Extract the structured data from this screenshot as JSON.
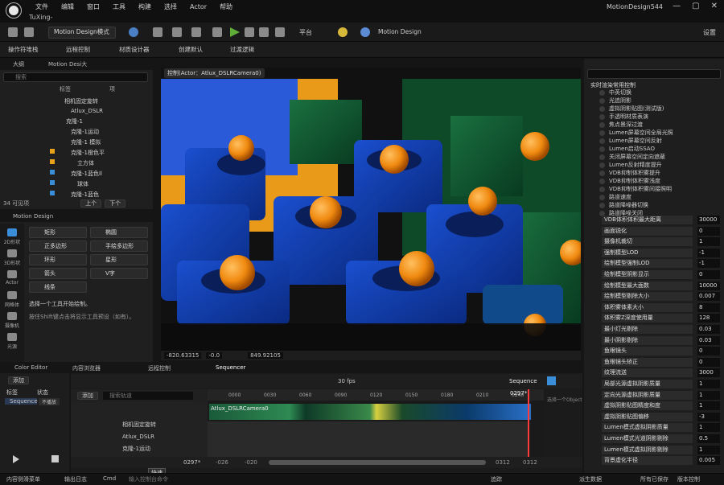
{
  "titlebar": {
    "menus": [
      "文件",
      "编辑",
      "窗口",
      "工具",
      "构建",
      "选择",
      "Actor",
      "帮助"
    ],
    "project": "TuXing-",
    "window_name": "MotionDesign544"
  },
  "toolbar": {
    "mode": "Motion Design模式",
    "platform": "平台",
    "md": "Motion Design",
    "settings": "设置"
  },
  "toolbar2": {
    "items": [
      "操作符堆栈",
      "远程控制",
      "材质设计器",
      "创建默认",
      "过渡逻辑"
    ]
  },
  "outliner": {
    "tab": "大纲",
    "tab2": "Motion Desi大",
    "search": "搜索",
    "col_label": "标签",
    "col_item": "项",
    "rows": [
      "相机固定旋转",
      "Atlux_DSLR",
      "克隆-1",
      "克隆-1运动",
      "克隆-1 模拟",
      "克隆-1橙色平",
      "立方体",
      "克隆-1蓝色Il",
      "球体",
      "克隆-1蓝色"
    ],
    "count": "34 可见项",
    "btn_up": "上个",
    "btn_down": "下个"
  },
  "motion": {
    "tab": "Motion Design",
    "left": [
      "2D形状",
      "3D形状",
      "Actor",
      "网格体",
      "摄像机",
      "光源"
    ],
    "shapes": [
      "矩形",
      "椭圆",
      "正多边形",
      "手绘多边形",
      "环形",
      "星形",
      "箭头",
      "V字",
      "线条"
    ],
    "hint1": "选择一个工具开始绘制。",
    "hint2": "按住Shift键点击将显示工具预设（如有）。"
  },
  "viewport": {
    "title": "控制(Actor：Atlux_DSLRCamera0)",
    "coords": [
      "-820.63315",
      "-0.0",
      "849.92105"
    ]
  },
  "right": {
    "section": "实时渲染常用控制",
    "toggles": [
      "中英切换",
      "光追阴影",
      "虚拟阴影贴图(测试版)",
      "手透明材质表演",
      "焦点景深过渡",
      "Lumen屏幕空间全局光照",
      "Lumen屏幕空间反射",
      "Lumen启动SSAO",
      "关闭屏幕空间定向遮蔽",
      "Lumen反射精度提升",
      "VDB抑制体积雾提升",
      "VDB抑制体积雾浅度",
      "VDB抑制体积雾间接照明",
      "路道速度",
      "路道降噪器切换",
      "路道降噪关闭"
    ],
    "props": [
      [
        "VDB体积体积最大距离",
        "30000"
      ],
      [
        "画面锐化",
        "0"
      ],
      [
        "摄像机裁切",
        "1"
      ],
      [
        "强制模型LOD",
        "-1"
      ],
      [
        "绘制模型强制LOD",
        "-1"
      ],
      [
        "绘制模型阴影显示",
        "0"
      ],
      [
        "绘制模型最大面数",
        "10000"
      ],
      [
        "绘制模型剔除大小",
        "0.007"
      ],
      [
        "体积雾体素大小",
        "8"
      ],
      [
        "体积雾Z深度使用量",
        "128"
      ],
      [
        "最小灯光剔除",
        "0.03"
      ],
      [
        "最小阴影剔除",
        "0.03"
      ],
      [
        "鱼眼镜头",
        "0"
      ],
      [
        "鱼眼镜头矫正",
        "0"
      ],
      [
        "纹理流送",
        "3000"
      ],
      [
        "局部光源虚拟阴影质量",
        "1"
      ],
      [
        "定向光源虚拟阴影质量",
        "1"
      ],
      [
        "虚拟阴影贴图精度和度",
        "1"
      ],
      [
        "虚拟阴影贴图偏移",
        "-3"
      ],
      [
        "Lumen模式虚拟阴影质量",
        "1"
      ],
      [
        "Lumen模式光道阴影剔除",
        "0.5"
      ],
      [
        "Lumen模式虚拟阴影剔除",
        "1"
      ],
      [
        "背景虚化半径",
        "0.005"
      ]
    ]
  },
  "bottom": {
    "tabs": [
      "Color Editor",
      "内容浏览器",
      "远程控制",
      "Sequencer"
    ],
    "color": {
      "add": "添加",
      "label": "标签",
      "state": "状态",
      "seq": "Sequence",
      "notplay": "不播放"
    },
    "seq": {
      "fps": "30 fps",
      "name": "Sequence",
      "add": "添加",
      "search": "搜索轨道",
      "tracks": [
        "相机固定旋转",
        "Atlux_DSLR",
        "克隆-1运动"
      ],
      "clip": "Atlux_DSLRCamera0",
      "frame": "0297*",
      "ticks": [
        "0000",
        "0030",
        "0060",
        "0090",
        "0120",
        "0150",
        "0180",
        "0210",
        "0240"
      ],
      "end1": "-026",
      "end2": "-020",
      "end3": "0312",
      "end4": "0312",
      "hint": "选择一个Object"
    }
  },
  "status": {
    "items": [
      "内容侧滑菜单",
      "输出日志",
      "Cmd",
      "输入控制台命令",
      "追踪",
      "派生数据",
      "所有已保存",
      "版本控制"
    ]
  },
  "tooltip": "快速"
}
